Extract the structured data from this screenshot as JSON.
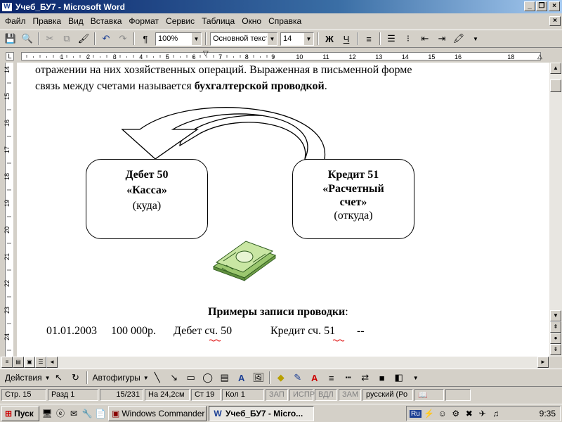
{
  "window": {
    "title": "Учеб_БУ7 - Microsoft Word",
    "app_icon": "W"
  },
  "menu": [
    "Файл",
    "Правка",
    "Вид",
    "Вставка",
    "Формат",
    "Сервис",
    "Таблица",
    "Окно",
    "Справка"
  ],
  "toolbar": {
    "zoom": "100%",
    "style": "Основной текст",
    "font_size": "14",
    "bold": "Ж",
    "underline": "Ч",
    "pilcrow": "¶"
  },
  "ruler": {
    "h_numbers": [
      "1",
      "2",
      "3",
      "4",
      "5",
      "6",
      "7",
      "8",
      "9",
      "10",
      "11",
      "12",
      "13",
      "14",
      "15",
      "16",
      "18"
    ],
    "v_numbers": [
      "14",
      "15",
      "16",
      "17",
      "18",
      "19",
      "20",
      "21",
      "22",
      "23",
      "24"
    ]
  },
  "document": {
    "line1": "отражении на них хозяйственных операций. Выраженная в письменной форме",
    "line2_plain": "связь между счетами называется ",
    "line2_bold": "бухгалтерской проводкой",
    "line2_end": ".",
    "box_left": {
      "line1": "Дебет 50",
      "line2": "«Касса»",
      "line3": "(куда)"
    },
    "box_right": {
      "line1": "Кредит 51",
      "line2": "«Расчетный",
      "line3": "счет»",
      "line4": "(откуда)"
    },
    "examples_heading": "Примеры записи проводки",
    "examples_colon": ":",
    "entry": {
      "date": "01.01.2003",
      "amount": "100 000р.",
      "debit": "Дебет сч. 50",
      "credit": "Кредит сч. 51",
      "dash": "--"
    }
  },
  "drawing": {
    "actions": "Действия",
    "autoshapes": "Автофигуры"
  },
  "status": {
    "page": "Стр. 15",
    "section": "Разд 1",
    "pages": "15/231",
    "at": "На 24,2см",
    "line": "Ст 19",
    "col": "Кол 1",
    "rec": "ЗАП",
    "trk": "ИСПР",
    "ext": "ВДЛ",
    "ovr": "ЗАМ",
    "lang": "русский (Ро"
  },
  "taskbar": {
    "start": "Пуск",
    "items": [
      "Windows Commander ...",
      "Учеб_БУ7 - Micro..."
    ],
    "lang": "Ru",
    "clock": "9:35"
  },
  "colors": {
    "title_start": "#0a246a",
    "title_end": "#a6caf0",
    "face": "#d4d0c8"
  }
}
